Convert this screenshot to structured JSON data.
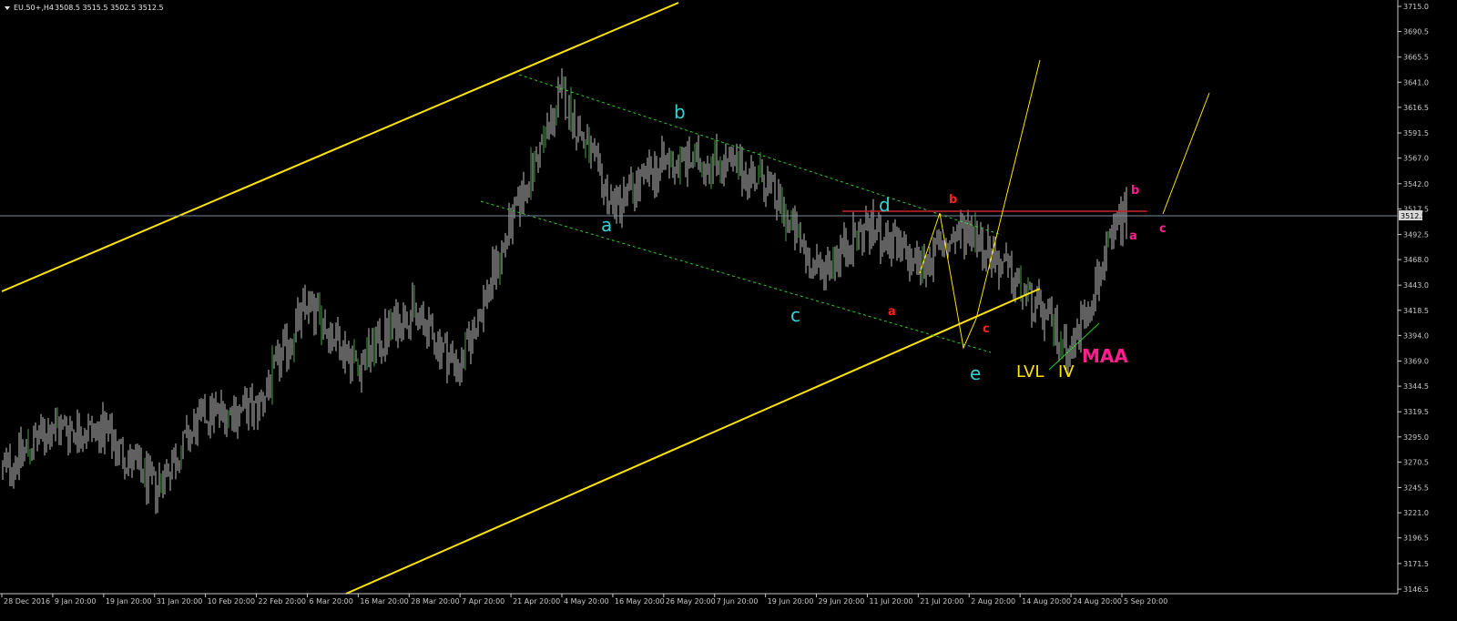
{
  "header": {
    "symbol": "EU.50+,H4",
    "ohlc": "3508.5 3515.5 3502.5 3512.5"
  },
  "colors": {
    "background": "#000000",
    "candles": "#c0c0c0",
    "bull_tick": "#3fa63f",
    "channel": "#ffe400",
    "dotted_channel": "#2ecc2e",
    "resistance": "#cc2222",
    "price_line": "#7a8c99",
    "wave_cyan": "#34d2d6",
    "wave_red": "#ff2020",
    "wave_pink": "#ff1e8c",
    "wave_yellow": "#ffe400"
  },
  "chart_data": {
    "type": "candlestick",
    "ylim": [
      3146.5,
      3715.0
    ],
    "y_ticks": [
      "3715.0",
      "3690.5",
      "3665.5",
      "3641.0",
      "3616.5",
      "3591.5",
      "3567.0",
      "3542.0",
      "3517.5",
      "3492.5",
      "3468.0",
      "3443.0",
      "3418.5",
      "3394.0",
      "3369.0",
      "3344.5",
      "3319.5",
      "3295.0",
      "3270.5",
      "3245.5",
      "3221.0",
      "3196.5",
      "3171.5",
      "3146.5"
    ],
    "x_ticks": [
      "28 Dec 2016",
      "9 Jan 20:00",
      "19 Jan 20:00",
      "31 Jan 20:00",
      "10 Feb 20:00",
      "22 Feb 20:00",
      "6 Mar 20:00",
      "16 Mar 20:00",
      "28 Mar 20:00",
      "7 Apr 20:00",
      "21 Apr 20:00",
      "4 May 20:00",
      "16 May 20:00",
      "26 May 20:00",
      "7 Jun 20:00",
      "19 Jun 20:00",
      "29 Jun 20:00",
      "11 Jul 20:00",
      "21 Jul 20:00",
      "2 Aug 20:00",
      "14 Aug 20:00",
      "24 Aug 20:00",
      "5 Sep 20:00"
    ],
    "current_price": "3512.5",
    "price_path": [
      [
        "28 Dec 2016",
        3262
      ],
      [
        "9 Jan 20:00",
        3305
      ],
      [
        "19 Jan 20:00",
        3300
      ],
      [
        "31 Jan 20:00",
        3245
      ],
      [
        "10 Feb 20:00",
        3318
      ],
      [
        "22 Feb 20:00",
        3322
      ],
      [
        "6 Mar 20:00",
        3425
      ],
      [
        "16 Mar 20:00",
        3365
      ],
      [
        "28 Mar 20:00",
        3420
      ],
      [
        "7 Apr 20:00",
        3362
      ],
      [
        "21 Apr 20:00",
        3502
      ],
      [
        "4 May 20:00",
        3630
      ],
      [
        "16 May 20:00",
        3520
      ],
      [
        "26 May 20:00",
        3562
      ],
      [
        "7 Jun 20:00",
        3565
      ],
      [
        "19 Jun 20:00",
        3545
      ],
      [
        "29 Jun 20:00",
        3455
      ],
      [
        "11 Jul 20:00",
        3500
      ],
      [
        "21 Jul 20:00",
        3462
      ],
      [
        "2 Aug 20:00",
        3500
      ],
      [
        "14 Aug 20:00",
        3440
      ],
      [
        "24 Aug 20:00",
        3380
      ],
      [
        "5 Sep 20:00",
        3512.5
      ]
    ],
    "wave_labels": [
      {
        "text": "a",
        "group": "cyan"
      },
      {
        "text": "b",
        "group": "cyan"
      },
      {
        "text": "c",
        "group": "cyan"
      },
      {
        "text": "d",
        "group": "cyan"
      },
      {
        "text": "e",
        "group": "cyan"
      },
      {
        "text": "a",
        "group": "red"
      },
      {
        "text": "b",
        "group": "red"
      },
      {
        "text": "c",
        "group": "red"
      },
      {
        "text": "a",
        "group": "pink"
      },
      {
        "text": "b",
        "group": "pink"
      },
      {
        "text": "c",
        "group": "pink"
      },
      {
        "text": "LVL",
        "group": "yellow"
      },
      {
        "text": "IV",
        "group": "yellow"
      },
      {
        "text": "MAA",
        "group": "pink-big"
      }
    ]
  }
}
